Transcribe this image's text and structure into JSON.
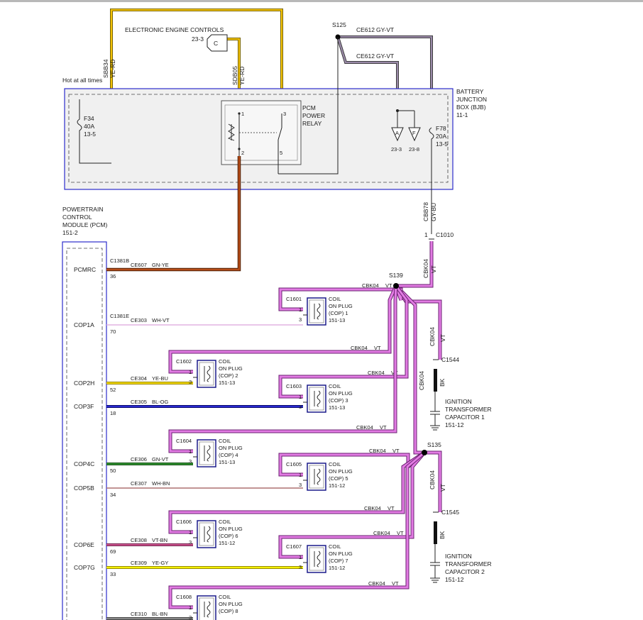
{
  "header": {
    "eec_label": "ELECTRONIC ENGINE CONTROLS",
    "eec_ref": "23-3",
    "connector_c": "C",
    "hot_label": "Hot at all times"
  },
  "bjb": {
    "label": [
      "BATTERY",
      "JUNCTION",
      "BOX (BJB)",
      "11-1"
    ],
    "fuse_f34": [
      "F34",
      "40A",
      "13-5"
    ],
    "fuse_f78": [
      "F78",
      "20A",
      "13-5"
    ],
    "relay": [
      "PCM",
      "POWER",
      "RELAY"
    ],
    "relay_pins": [
      "1",
      "2",
      "3",
      "5"
    ],
    "ground_refs": [
      "23-3",
      "23-8"
    ],
    "ground_letters": [
      "A",
      "F"
    ]
  },
  "wires_top": {
    "sbb34": [
      "SBB34",
      "YE-RD"
    ],
    "sdb05": [
      "SDB05",
      "YE-RD"
    ],
    "splice_s125": "S125",
    "ce612_a": [
      "CE612",
      "GY-VT"
    ],
    "ce612_b": [
      "CE612",
      "GY-VT"
    ],
    "cbb78": [
      "CBB78",
      "GY-BU"
    ],
    "c1010": "C1010",
    "c1010_pin": "1"
  },
  "pcm": {
    "label": [
      "POWERTRAIN",
      "CONTROL",
      "MODULE (PCM)",
      "151-2"
    ],
    "signals": [
      {
        "name": "PCMRC",
        "connector": "C1381B",
        "pin": "36",
        "circuit": "CE607",
        "color": "GN-YE"
      },
      {
        "name": "COP1A",
        "connector": "C1381E",
        "pin": "70",
        "circuit": "CE303",
        "color": "WH-VT"
      },
      {
        "name": "COP2H",
        "connector": "",
        "pin": "52",
        "circuit": "CE304",
        "color": "YE-BU"
      },
      {
        "name": "COP3F",
        "connector": "",
        "pin": "18",
        "circuit": "CE305",
        "color": "BL-OG"
      },
      {
        "name": "COP4C",
        "connector": "",
        "pin": "50",
        "circuit": "CE306",
        "color": "GN-VT"
      },
      {
        "name": "COP5B",
        "connector": "",
        "pin": "34",
        "circuit": "CE307",
        "color": "WH-BN"
      },
      {
        "name": "COP6E",
        "connector": "",
        "pin": "69",
        "circuit": "CE308",
        "color": "VT-BN"
      },
      {
        "name": "COP7G",
        "connector": "",
        "pin": "33",
        "circuit": "CE309",
        "color": "YE-GY"
      },
      {
        "name": "",
        "connector": "",
        "pin": "",
        "circuit": "CE310",
        "color": "BL-BN"
      }
    ]
  },
  "coils": [
    {
      "conn": "C1601",
      "lines": [
        "COIL",
        "ON PLUG",
        "(COP) 1",
        "151-13"
      ]
    },
    {
      "conn": "C1602",
      "lines": [
        "COIL",
        "ON PLUG",
        "(COP) 2",
        "151-13"
      ]
    },
    {
      "conn": "C1603",
      "lines": [
        "COIL",
        "ON PLUG",
        "(COP) 3",
        "151-13"
      ]
    },
    {
      "conn": "C1604",
      "lines": [
        "COIL",
        "ON PLUG",
        "(COP) 4",
        "151-13"
      ]
    },
    {
      "conn": "C1605",
      "lines": [
        "COIL",
        "ON PLUG",
        "(COP) 5",
        "151-12"
      ]
    },
    {
      "conn": "C1606",
      "lines": [
        "COIL",
        "ON PLUG",
        "(COP) 6",
        "151-12"
      ]
    },
    {
      "conn": "C1607",
      "lines": [
        "COIL",
        "ON PLUG",
        "(COP) 7",
        "151-12"
      ]
    },
    {
      "conn": "C1608",
      "lines": [
        "COIL",
        "ON PLUG",
        "(COP) 8"
      ]
    }
  ],
  "coil_pins": [
    "1",
    "3"
  ],
  "vt_wires": {
    "cbk04": "CBK04",
    "vt": "VT",
    "s139": "S139",
    "s135": "S135",
    "c1544": "C1544",
    "c1545": "C1545",
    "bk": "BK",
    "itc1": [
      "IGNITION",
      "TRANSFORMER",
      "CAPACITOR 1",
      "151-12"
    ],
    "itc2": [
      "IGNITION",
      "TRANSFORMER",
      "CAPACITOR 2",
      "151-12"
    ]
  }
}
